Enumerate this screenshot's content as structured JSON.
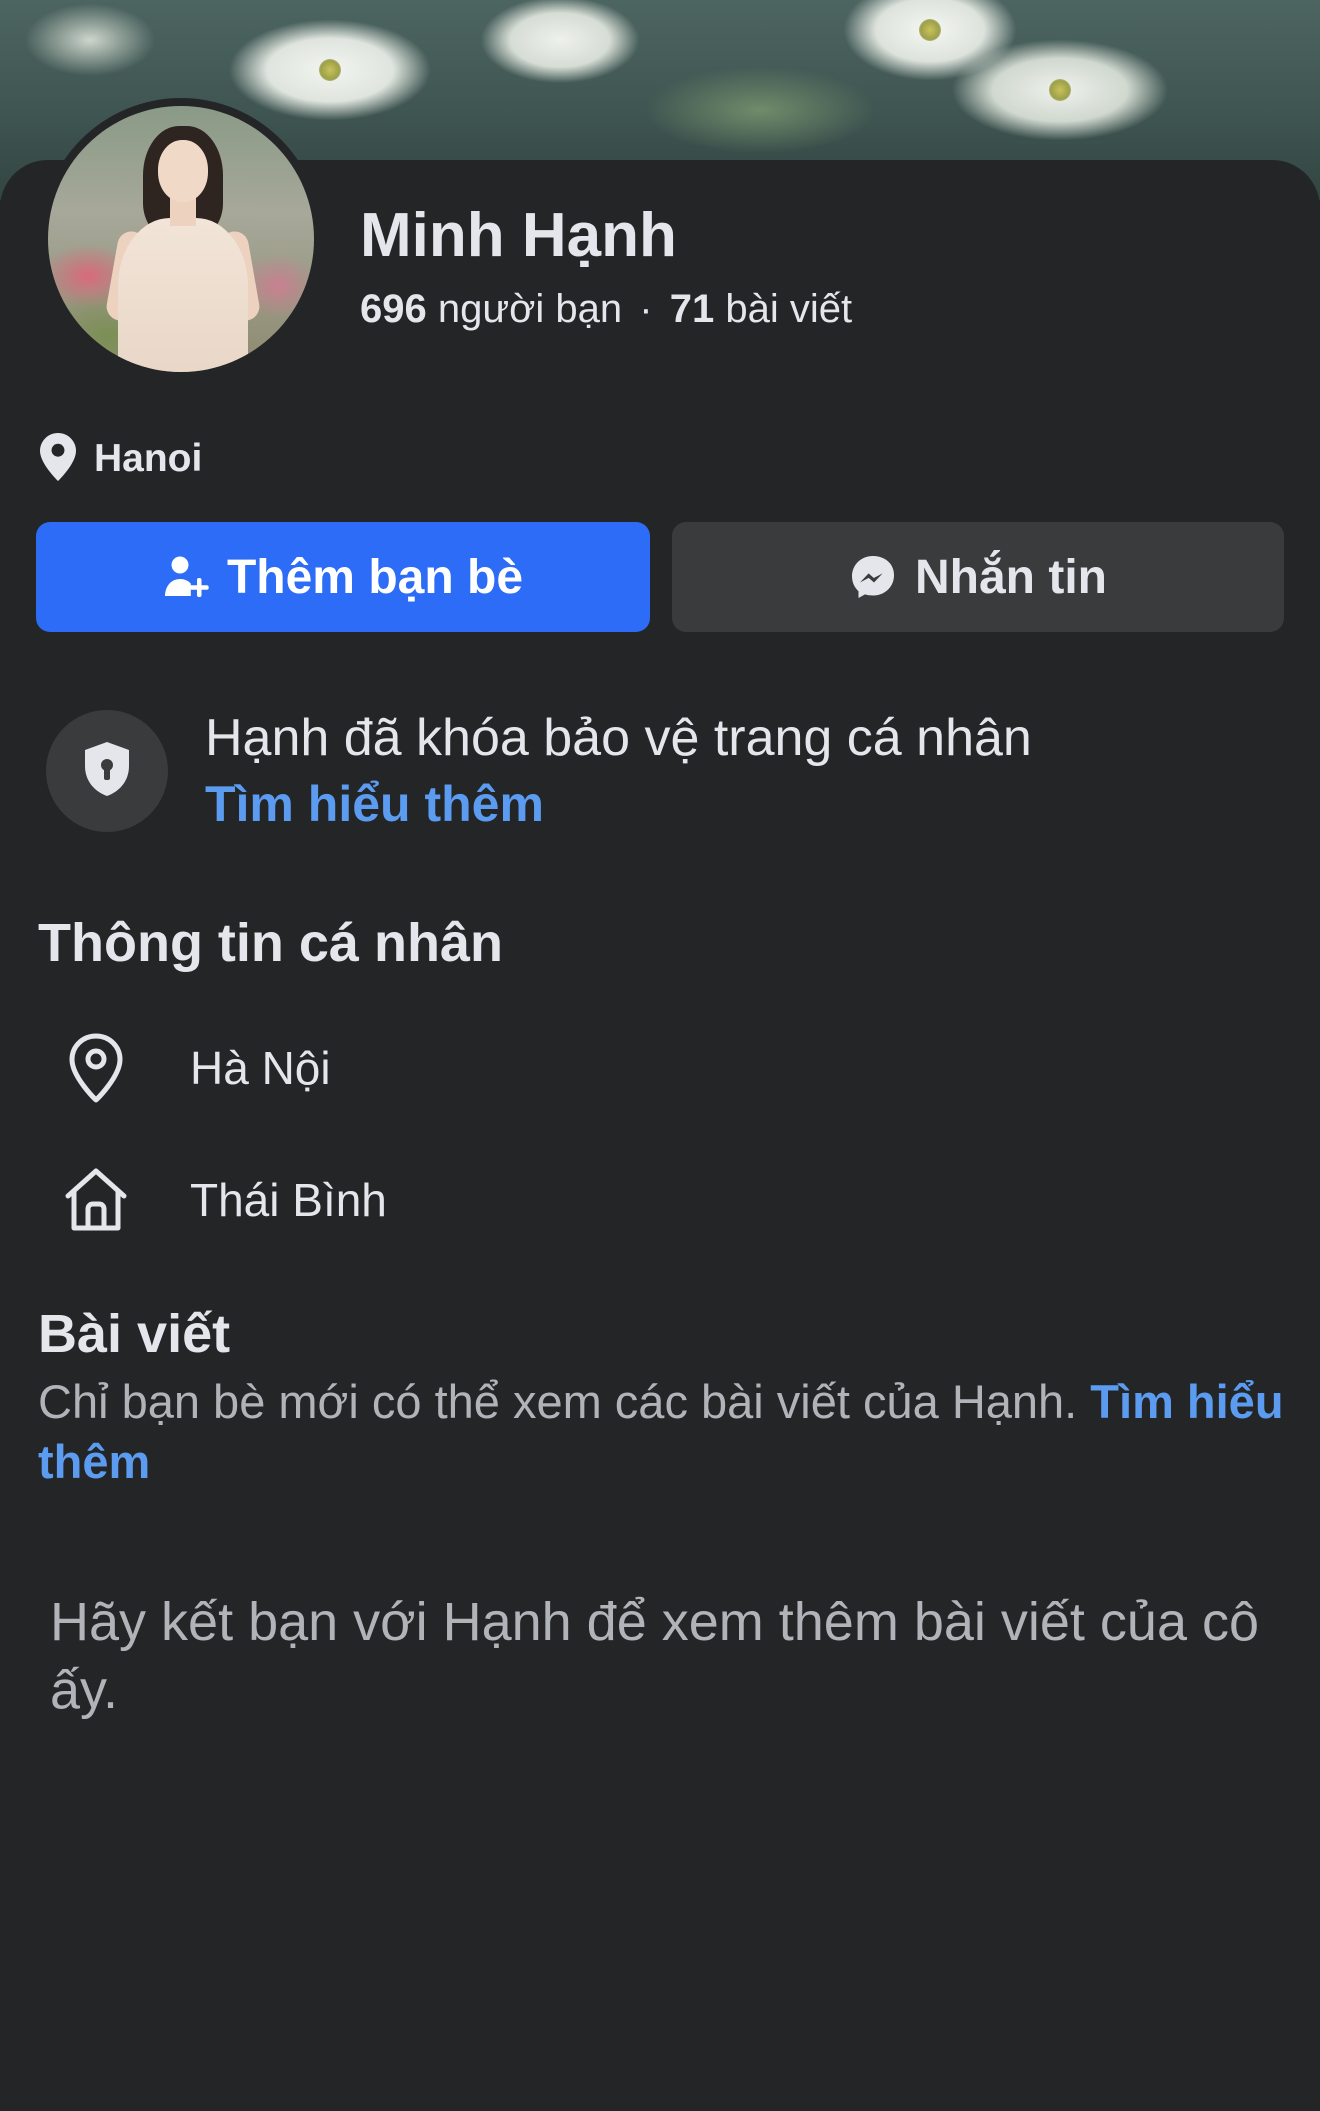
{
  "profile": {
    "name": "Minh Hạnh",
    "friends_count": "696",
    "friends_label": "người bạn",
    "separator": "·",
    "posts_count": "71",
    "posts_label": "bài viết",
    "location": "Hanoi"
  },
  "actions": {
    "add_friend_label": "Thêm bạn bè",
    "message_label": "Nhắn tin"
  },
  "locked_notice": {
    "title": "Hạnh đã khóa bảo vệ trang cá nhân",
    "link": "Tìm hiểu thêm"
  },
  "personal_info": {
    "title": "Thông tin cá nhân",
    "items": [
      {
        "icon": "location-pin-icon",
        "text": "Hà Nội"
      },
      {
        "icon": "home-icon",
        "text": "Thái Bình"
      }
    ]
  },
  "posts": {
    "title": "Bài viết",
    "description": "Chỉ bạn bè mới có thể xem các bài viết của Hạnh.",
    "link": "Tìm hiểu thêm",
    "friend_note": "Hãy kết bạn với Hạnh để xem thêm bài viết của cô ấy."
  },
  "colors": {
    "background": "#242527",
    "primary_button": "#2d6cf6",
    "secondary_button": "#3a3b3d",
    "link": "#5b9cf0",
    "secondary_text": "#b0b3b8"
  }
}
